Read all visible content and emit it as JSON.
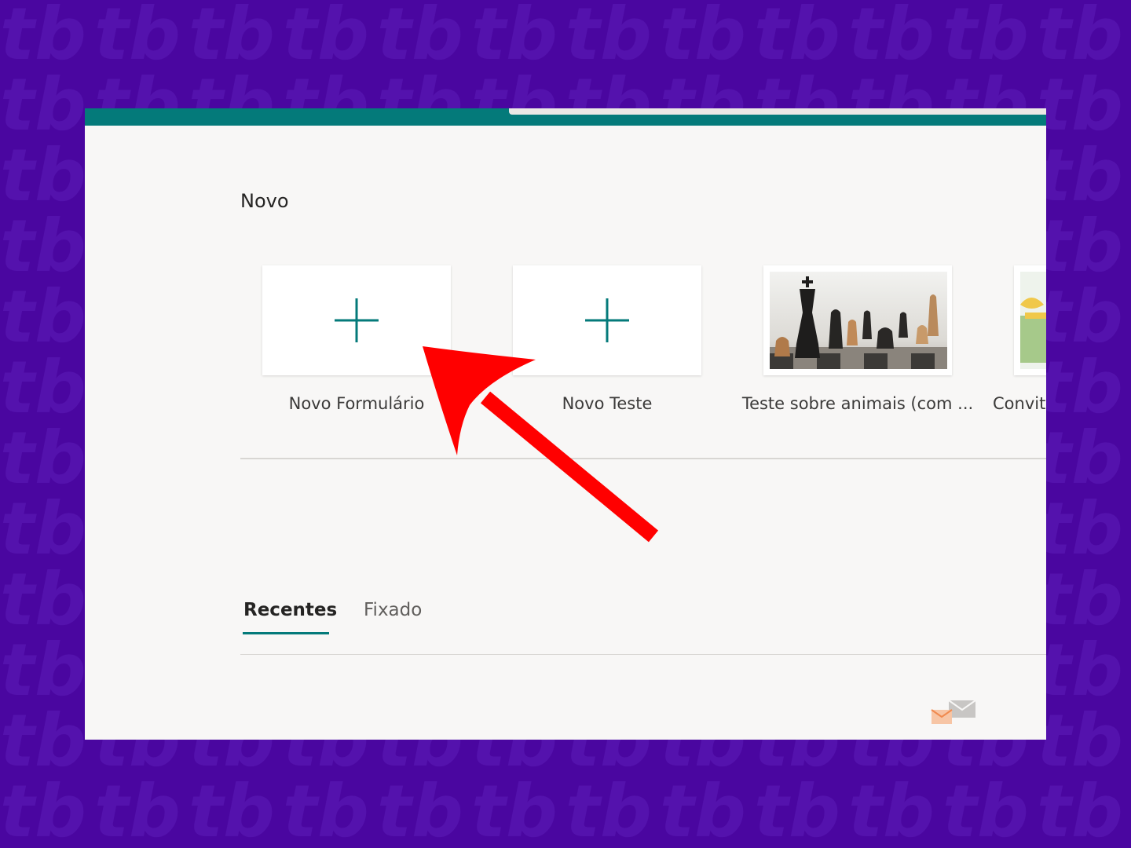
{
  "section": {
    "title": "Novo"
  },
  "cards": [
    {
      "label": "Novo Formulário",
      "icon": "plus-icon"
    },
    {
      "label": "Novo Teste",
      "icon": "plus-icon"
    },
    {
      "label": "Teste sobre animais (com ...",
      "icon": "chess-image"
    },
    {
      "label": "Convit",
      "icon": "gift-image"
    }
  ],
  "tabs": {
    "recent": "Recentes",
    "pinned": "Fixado"
  },
  "colors": {
    "accent": "#047a7a",
    "arrow": "#ff0000",
    "background": "#4a06a0"
  },
  "watermark": "tbtbtb"
}
